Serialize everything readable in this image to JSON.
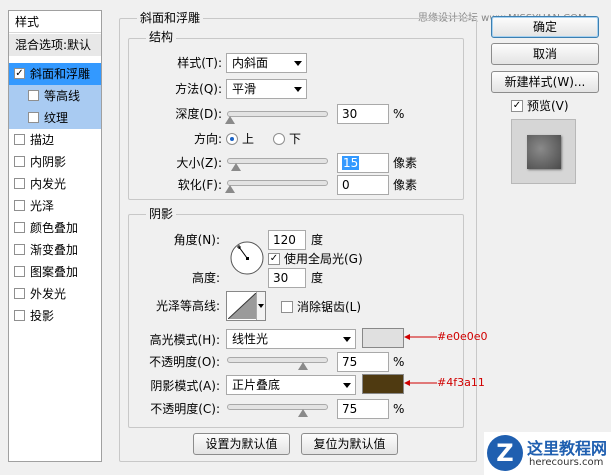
{
  "watermark_top": "思缘设计论坛  www.MISSYUAN.COM",
  "left_panel": {
    "title": "样式",
    "blend_options": "混合选项:默认",
    "items": [
      {
        "label": "斜面和浮雕",
        "checked": true,
        "state": "selected"
      },
      {
        "label": "等高线",
        "checked": false,
        "state": "sub"
      },
      {
        "label": "纹理",
        "checked": false,
        "state": "sub"
      },
      {
        "label": "描边",
        "checked": false
      },
      {
        "label": "内阴影",
        "checked": false
      },
      {
        "label": "内发光",
        "checked": false
      },
      {
        "label": "光泽",
        "checked": false
      },
      {
        "label": "颜色叠加",
        "checked": false
      },
      {
        "label": "渐变叠加",
        "checked": false
      },
      {
        "label": "图案叠加",
        "checked": false
      },
      {
        "label": "外发光",
        "checked": false
      },
      {
        "label": "投影",
        "checked": false
      }
    ]
  },
  "bevel": {
    "title": "斜面和浮雕",
    "structure": {
      "title": "结构",
      "style_label": "样式(T):",
      "style_value": "内斜面",
      "technique_label": "方法(Q):",
      "technique_value": "平滑",
      "depth_label": "深度(D):",
      "depth_value": "30",
      "depth_unit": "%",
      "direction_label": "方向:",
      "dir_up": "上",
      "dir_down": "下",
      "direction_selected": "上",
      "size_label": "大小(Z):",
      "size_value": "15",
      "size_unit": "像素",
      "soften_label": "软化(F):",
      "soften_value": "0",
      "soften_unit": "像素"
    },
    "shading": {
      "title": "阴影",
      "angle_label": "角度(N):",
      "angle_value": "120",
      "angle_unit": "度",
      "global_light_label": "使用全局光(G)",
      "global_light_checked": true,
      "altitude_label": "高度:",
      "altitude_value": "30",
      "altitude_unit": "度",
      "gloss_contour_label": "光泽等高线:",
      "anti_alias_label": "消除锯齿(L)",
      "anti_alias_checked": false,
      "highlight_mode_label": "高光模式(H):",
      "highlight_mode_value": "线性光",
      "highlight_color": "#e0e0e0",
      "highlight_annotation": "#e0e0e0",
      "highlight_opacity_label": "不透明度(O):",
      "highlight_opacity_value": "75",
      "highlight_opacity_unit": "%",
      "shadow_mode_label": "阴影模式(A):",
      "shadow_mode_value": "正片叠底",
      "shadow_color": "#4f3a11",
      "shadow_annotation": "#4f3a11",
      "shadow_opacity_label": "不透明度(C):",
      "shadow_opacity_value": "75",
      "shadow_opacity_unit": "%"
    },
    "make_default": "设置为默认值",
    "reset_default": "复位为默认值"
  },
  "right_panel": {
    "ok": "确定",
    "cancel": "取消",
    "new_style": "新建样式(W)...",
    "preview_label": "预览(V)",
    "preview_checked": true
  },
  "watermark_bottom": {
    "title": "这里教程网",
    "url": "herecours.com"
  }
}
